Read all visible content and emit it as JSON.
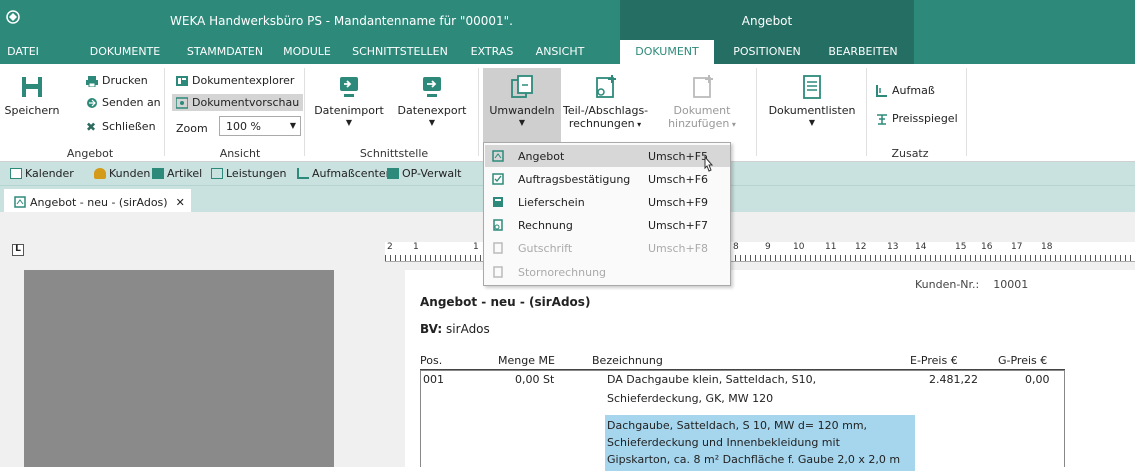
{
  "titlebar": {
    "title": "WEKA Handwerksbüro PS - Mandantenname für \"00001\".",
    "context_group": "Angebot",
    "app_icon": "weka-logo-icon"
  },
  "tabs": [
    "DATEI",
    "DOKUMENTE",
    "STAMMDATEN",
    "MODULE",
    "SCHNITTSTELLEN",
    "EXTRAS",
    "ANSICHT",
    "DOKUMENT",
    "POSITIONEN",
    "BEARBEITEN"
  ],
  "active_tab": "DOKUMENT",
  "ribbon": {
    "angebot": {
      "label": "Angebot",
      "save": "Speichern",
      "print": "Drucken",
      "send": "Senden an",
      "close": "Schließen"
    },
    "ansicht": {
      "label": "Ansicht",
      "explorer": "Dokumentexplorer",
      "preview": "Dokumentvorschau",
      "zoom_label": "Zoom",
      "zoom_value": "100 %"
    },
    "schnittstelle": {
      "label": "Schnittstelle",
      "import": "Datenimport",
      "export": "Datenexport"
    },
    "umwandeln": "Umwandeln",
    "teil_line1": "Teil-/Abschlags-",
    "teil_line2": "rechnungen",
    "dok_line1": "Dokument",
    "dok_line2": "hinzufügen",
    "doklisten": "Dokumentlisten",
    "zusatz": {
      "label": "Zusatz",
      "aufmass": "Aufmaß",
      "preisspiegel": "Preisspiegel"
    }
  },
  "quickbar": [
    "Kalender",
    "Kunden",
    "Artikel",
    "Leistungen",
    "Aufmaßcenter",
    "OP-Verwalt"
  ],
  "doc_tab": "Angebot - neu - (sirAdos)",
  "ruler_numbers": [
    "2",
    "1",
    "1",
    "8",
    "9",
    "10",
    "11",
    "12",
    "13",
    "14",
    "15",
    "16",
    "17",
    "18"
  ],
  "document": {
    "kunden_label": "Kunden-Nr.:",
    "kunden_value": "10001",
    "title": "Angebot - neu - (sirAdos)",
    "bv_label": "BV:",
    "bv_value": "sirAdos",
    "columns": [
      "Pos.",
      "Menge ME",
      "Bezeichnung",
      "E-Preis €",
      "G-Preis €"
    ],
    "row": {
      "pos": "001",
      "menge": "0,00 St",
      "bez_line1": "DA Dachgaube klein, Satteldach, S10,",
      "bez_line2": "Schieferdeckung, GK, MW 120",
      "epreis": "2.481,22",
      "gpreis": "0,00",
      "long1": "Dachgaube, Satteldach, S 10, MW d= 120 mm,",
      "long2": "Schieferdeckung und Innenbekleidung mit",
      "long3": "Gipskarton, ca. 8 m² Dachfläche f. Gaube 2,0 x 2,0 m"
    }
  },
  "dropdown": [
    {
      "label": "Angebot",
      "key": "Umsch+F5",
      "state": "hover"
    },
    {
      "label": "Auftragsbestätigung",
      "key": "Umsch+F6",
      "state": "normal"
    },
    {
      "label": "Lieferschein",
      "key": "Umsch+F9",
      "state": "normal"
    },
    {
      "label": "Rechnung",
      "key": "Umsch+F7",
      "state": "normal"
    },
    {
      "label": "Gutschrift",
      "key": "Umsch+F8",
      "state": "disabled"
    },
    {
      "label": "Stornorechnung",
      "key": "",
      "state": "disabled"
    }
  ],
  "colors": {
    "titlebar": "#2d8a7a",
    "context": "#246e63",
    "quickbar": "#c9e2e0",
    "highlight": "#a6d6ee"
  }
}
